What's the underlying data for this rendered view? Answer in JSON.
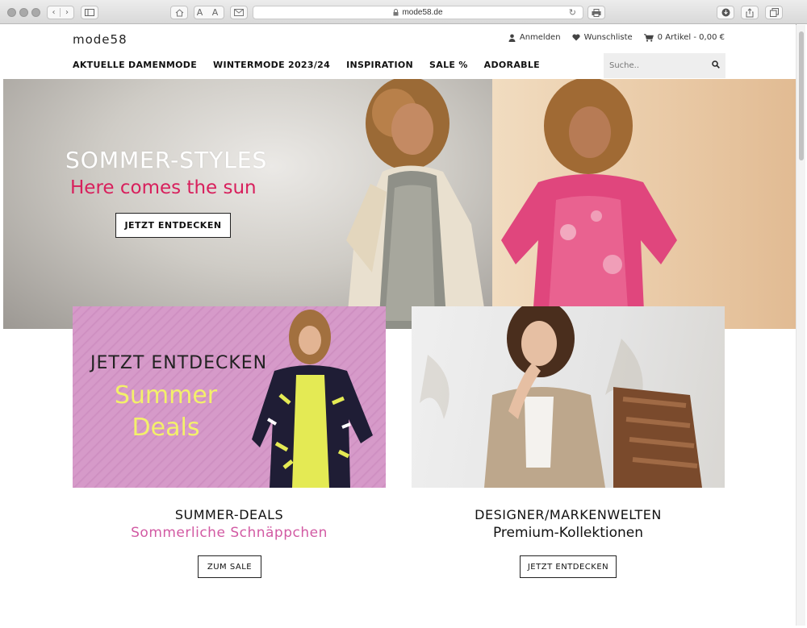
{
  "browser": {
    "url": "mode58.de",
    "aa_label": "A A",
    "back_glyph": "‹",
    "forward_glyph": "›",
    "plus_glyph": "+"
  },
  "site": {
    "logo": "mode58",
    "account_label": "Anmelden",
    "wishlist_label": "Wunschliste",
    "cart_label": "0 Artikel - 0,00 €"
  },
  "nav": {
    "items": [
      {
        "label": "AKTUELLE DAMENMODE"
      },
      {
        "label": "WINTERMODE 2023/24"
      },
      {
        "label": "INSPIRATION"
      },
      {
        "label": "SALE %"
      },
      {
        "label": "ADORABLE"
      }
    ]
  },
  "search": {
    "placeholder": "Suche..",
    "icon": "magnifier-icon"
  },
  "hero": {
    "title": "SOMMER-STYLES",
    "subtitle": "Here comes the sun",
    "cta": "JETZT ENTDECKEN",
    "subtitle_color": "#d81f5c"
  },
  "tiles": [
    {
      "image_heading": "JETZT ENTDECKEN",
      "image_text_line1": "Summer",
      "image_text_line2": "Deals",
      "caption_title": "SUMMER-DEALS",
      "caption_sub": "Sommerliche Schnäppchen",
      "button": "ZUM SALE",
      "sub_color": "#d25aa3"
    },
    {
      "caption_title": "DESIGNER/MARKENWELTEN",
      "caption_sub": "Premium-Kollektionen",
      "button": "JETZT ENTDECKEN"
    }
  ]
}
